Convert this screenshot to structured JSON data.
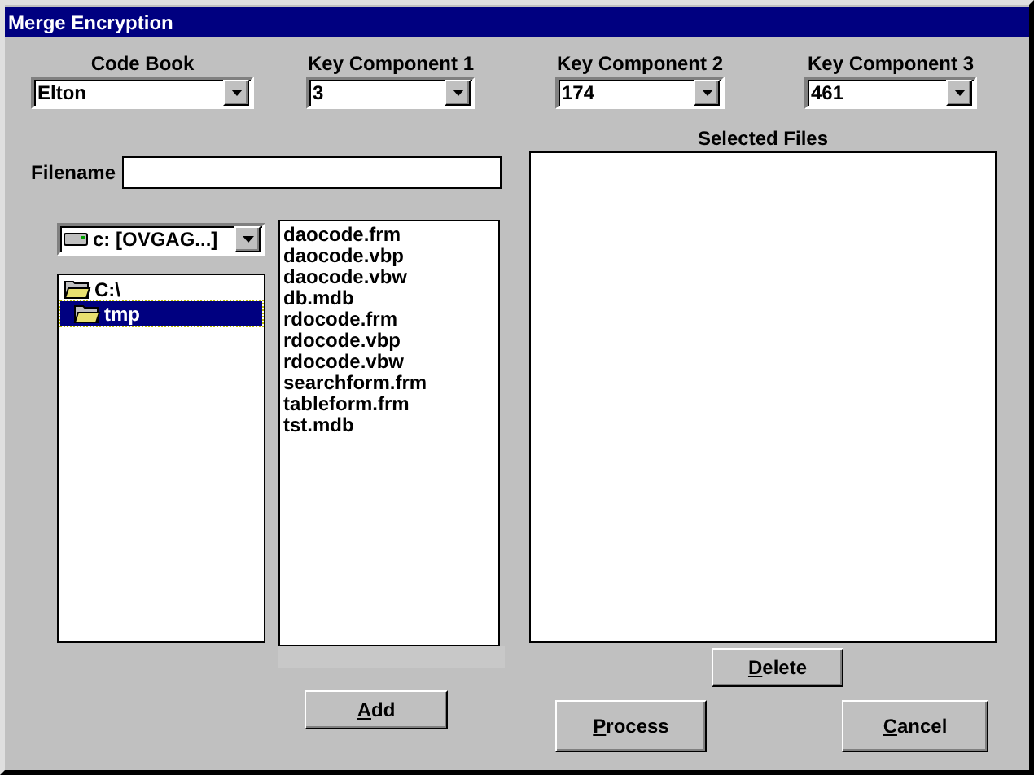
{
  "window": {
    "title": "Merge Encryption"
  },
  "combos": [
    {
      "label": "Code Book",
      "value": "Elton"
    },
    {
      "label": "Key Component 1",
      "value": "3"
    },
    {
      "label": "Key Component 2",
      "value": "174"
    },
    {
      "label": "Key Component 3",
      "value": "461"
    }
  ],
  "filename": {
    "label": "Filename"
  },
  "drive": {
    "value": "c: [OVGAG...]"
  },
  "folders": [
    {
      "name": "C:\\",
      "selected": false,
      "children": [
        {
          "name": "tmp",
          "selected": true
        }
      ]
    }
  ],
  "files": [
    "daocode.frm",
    "daocode.vbp",
    "daocode.vbw",
    "db.mdb",
    "rdocode.frm",
    "rdocode.vbp",
    "rdocode.vbw",
    "searchform.frm",
    "tableform.frm",
    "tst.mdb"
  ],
  "selected_files": {
    "label": "Selected Files"
  },
  "add_button": {
    "mnemonic": "A",
    "rest": "dd"
  },
  "delete_button": {
    "mnemonic": "D",
    "rest": "elete"
  },
  "process_button": {
    "mnemonic": "P",
    "rest": "rocess"
  },
  "cancel_button": {
    "mnemonic": "C",
    "rest": "ancel"
  }
}
